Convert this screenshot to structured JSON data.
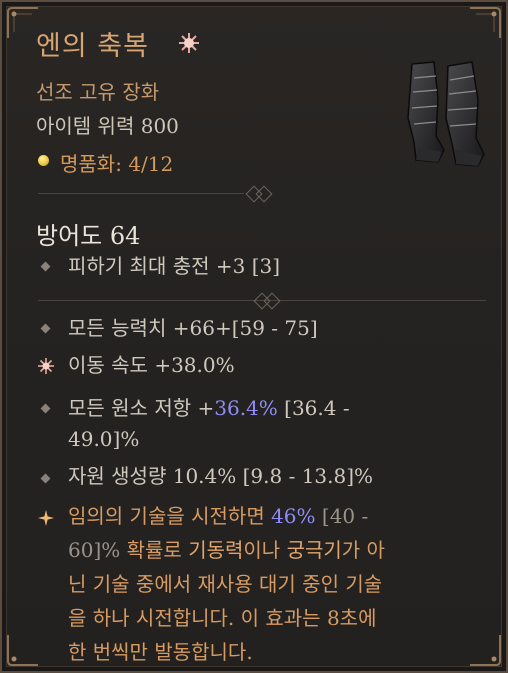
{
  "item": {
    "name": "엔의 축복",
    "type_line": "선조 고유 장화",
    "item_power": "아이템 위력 800",
    "masterwork_label": "명품화:",
    "masterwork_value": "4/12",
    "icon": "boots-item-icon"
  },
  "armor": "방어도 64",
  "implicit": {
    "label": "피하기 최대 충전",
    "value": "+3",
    "range": "[3]"
  },
  "affixes": [
    {
      "label": "모든 능력치",
      "value": "+66",
      "range": "+[59 - 75]"
    },
    {
      "label": "이동 속도",
      "value": "+38.0%",
      "range": ""
    },
    {
      "label": "모든 원소 저항",
      "value_prefix": "+",
      "value": "36.4%",
      "range_line1": "[36.4 -",
      "range_line2": "49.0]%"
    },
    {
      "label": "자원 생성량",
      "value": "10.4%",
      "range": "[9.8 - 13.8]%"
    }
  ],
  "unique_power": {
    "part1": "임의의 기술을 시전하면 ",
    "value": "46%",
    "range_line1": " [40 -",
    "range_line2": "60]%",
    "part2": " 확률로 ",
    "kw1": "기동력",
    "part3": "이나 ",
    "kw2": "궁극기",
    "part4": "가 아",
    "line3": "닌 기술 중에서 재사용 대기 중인 기술",
    "line4": "을 하나 시전합니다. 이 효과는 8초에",
    "line5": "한 번씩만 발동합니다."
  },
  "colors": {
    "title": "#d7a571",
    "unique_text": "#d79b62",
    "highlight_value": "#8f8cf3",
    "masterwork_dot": "#e9c43a"
  }
}
